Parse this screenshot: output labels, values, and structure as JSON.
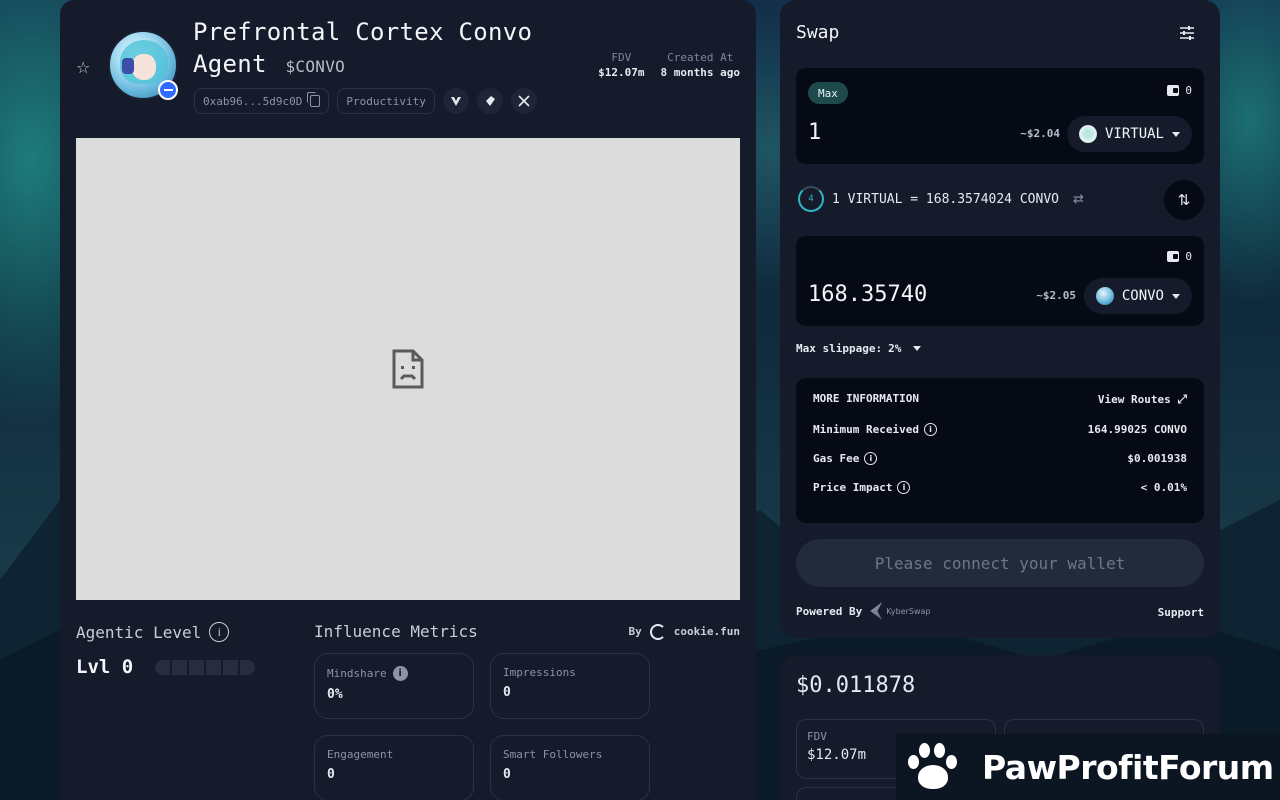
{
  "agent": {
    "name": "Prefrontal Cortex Convo Agent",
    "ticker": "$CONVO",
    "address": "0xab96...5d9c0D",
    "category": "Productivity",
    "stats": [
      {
        "label": "FDV",
        "value": "$12.07m"
      },
      {
        "label": "Created At",
        "value": "8 months ago"
      }
    ],
    "social_icons": [
      "virtuals-icon",
      "website-icon",
      "x-icon"
    ]
  },
  "agentic": {
    "label": "Agentic Level",
    "level": "Lvl 0",
    "level_filled": 0,
    "level_total": 6
  },
  "influence": {
    "title": "Influence Metrics",
    "by_label": "By",
    "provider": "cookie.fun",
    "metrics": [
      {
        "label": "Mindshare",
        "value": "0%"
      },
      {
        "label": "Impressions",
        "value": "0"
      },
      {
        "label": "Engagement",
        "value": "0"
      },
      {
        "label": "Smart Followers",
        "value": "0"
      }
    ]
  },
  "swap": {
    "title": "Swap",
    "max_label": "Max",
    "from": {
      "balance": "0",
      "amount": "1",
      "usd": "~$2.04",
      "token": "VIRTUAL"
    },
    "rate": {
      "timer": "4",
      "text": "1 VIRTUAL = 168.3574024 CONVO"
    },
    "to": {
      "balance": "0",
      "amount": "168.35740",
      "usd": "~$2.05",
      "token": "CONVO"
    },
    "slippage_label": "Max slippage:",
    "slippage_value": "2%",
    "more_info": {
      "title": "MORE INFORMATION",
      "view_routes": "View Routes",
      "rows": [
        {
          "label": "Minimum Received",
          "value": "164.99025 CONVO"
        },
        {
          "label": "Gas Fee",
          "value": "$0.001938"
        },
        {
          "label": "Price Impact",
          "value": "< 0.01%"
        }
      ]
    },
    "connect_label": "Please connect your wallet",
    "powered_by": "Powered By",
    "kyber_label": "KyberSwap",
    "support": "Support"
  },
  "price_panel": {
    "price": "$0.011878",
    "cards": [
      {
        "label": "FDV",
        "value": "$12.07m"
      }
    ]
  },
  "watermark": "PawProfitForum",
  "colors": {
    "accent_teal": "#2fb7c4",
    "panel": "#151b2b",
    "box": "#050a14"
  }
}
